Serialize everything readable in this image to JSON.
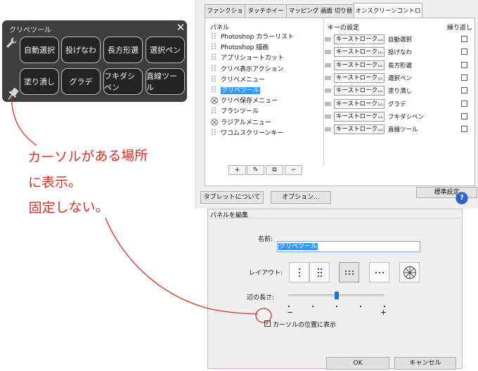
{
  "palette": {
    "title": "クリペツール",
    "close": "✕",
    "buttons": [
      "自動選択",
      "投げなわ",
      "長方形選",
      "選択ペン",
      "塗り潰し",
      "グラデ",
      "フキダシペン",
      "直線ツール"
    ]
  },
  "settings": {
    "tabs": [
      "ファンクションキー",
      "タッチホイール",
      "マッピング 画面 切り替え",
      "オンスクリーンコントロール"
    ],
    "active_tab": 3,
    "panel_header": "パネル",
    "key_header": "キーの設定",
    "repeat_header": "繰り返し",
    "panel_items": [
      {
        "label": "Photoshop カラーリスト",
        "icon": "dots-grid-icon"
      },
      {
        "label": "Photoshop 描画",
        "icon": "dots-grid-icon"
      },
      {
        "label": "アプリショートカット",
        "icon": "dots-grid-icon"
      },
      {
        "label": "クリペ表示アクション",
        "icon": "dots-grid-icon"
      },
      {
        "label": "クリペメニュー",
        "icon": "dots-grid-icon"
      },
      {
        "label": "クリペツール",
        "icon": "dots-grid-icon"
      },
      {
        "label": "クリペ保存メニュー",
        "icon": "radial-icon"
      },
      {
        "label": "ブラシツール",
        "icon": "dots-grid-icon"
      },
      {
        "label": "ラジアルメニュー",
        "icon": "radial-icon"
      },
      {
        "label": "ワコムスクリーンキー",
        "icon": "dots-grid-icon"
      }
    ],
    "selected_panel": 5,
    "tool_buttons": [
      "+",
      "✎",
      "⧉",
      "−"
    ],
    "keys": [
      {
        "type": "キーストローク...",
        "name": "自動選択"
      },
      {
        "type": "キーストローク...",
        "name": "投げなわ"
      },
      {
        "type": "キーストローク...",
        "name": "長方形選"
      },
      {
        "type": "キーストローク...",
        "name": "選択ペン"
      },
      {
        "type": "キーストローク...",
        "name": "塗り潰し"
      },
      {
        "type": "キーストローク...",
        "name": "グラデ"
      },
      {
        "type": "キーストローク...",
        "name": "フキダシペン"
      },
      {
        "type": "キーストローク...",
        "name": "直線ツール"
      }
    ],
    "default_button": "標準設定",
    "tablet_button": "タブレットについて",
    "options_button": "オプション...",
    "help_button": "?"
  },
  "edit_panel": {
    "title": "パネルを編集",
    "name_label": "名前:",
    "name_value": "クリペツール",
    "layout_label": "レイアウト:",
    "edge_label": "辺の長さ:",
    "edge_min": "−",
    "edge_max": "+",
    "edge_level": 0.5,
    "cursor_checkbox_label": "カーソルの位置に表示",
    "cursor_checked": true,
    "ok_button": "OK",
    "cancel_button": "キャンセル"
  },
  "note": {
    "lines": [
      "カーソルがある場所",
      "に表示。",
      "固定しない。"
    ],
    "color": "#d63028"
  },
  "colors": {
    "selection": "#3399ff",
    "slider": "#1e73d6",
    "palette_bg": "#3e3e3e"
  }
}
